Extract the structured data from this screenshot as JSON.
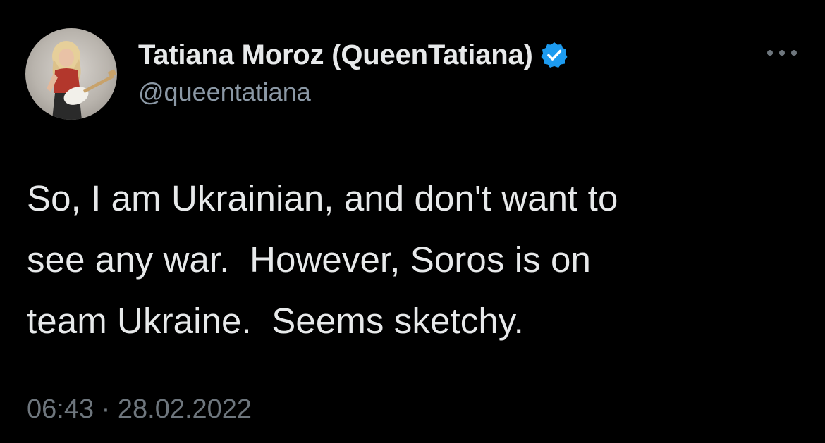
{
  "tweet": {
    "author": {
      "display_name": "Tatiana Moroz (QueenTatiana)",
      "handle": "@queentatiana",
      "verified": true,
      "avatar_icon": "profile-photo-guitar"
    },
    "text": "So, I am Ukrainian, and don't want to\nsee any war.  However, Soros is on\nteam Ukraine.  Seems sketchy.",
    "time": "06:43",
    "separator": "·",
    "date": "28.02.2022",
    "more_icon": "more-horizontal-icon"
  },
  "colors": {
    "background": "#000000",
    "primary_text": "#e7e9ea",
    "secondary_text": "#8b98a5",
    "meta_text": "#6e767d",
    "verified_blue": "#1d9bf0"
  }
}
